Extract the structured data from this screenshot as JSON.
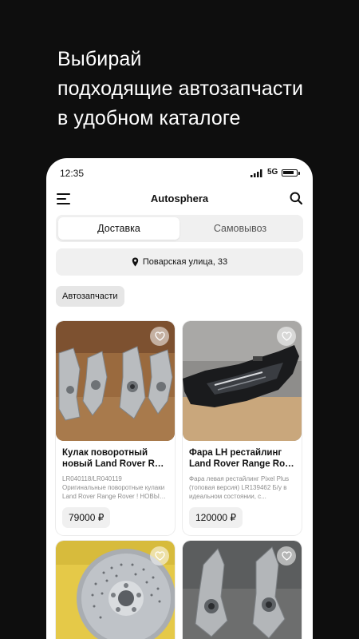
{
  "promo": {
    "line1": "Выбирай",
    "line2": "подходящие автозапчасти",
    "line3": "в удобном каталоге"
  },
  "status_bar": {
    "time": "12:35",
    "network": "5G"
  },
  "app": {
    "title": "Autosphera",
    "menu_icon": "menu-icon",
    "search_icon": "search-icon"
  },
  "delivery_toggle": {
    "options": [
      "Доставка",
      "Самовывоз"
    ],
    "selected": "Доставка"
  },
  "address": {
    "icon": "location-pin-icon",
    "text": "Поварская улица, 33"
  },
  "category_chip": "Автозапчасти",
  "products": [
    {
      "title_line1": "Кулак поворотный",
      "title_line2": "новый Land Rover Range...",
      "desc_line1": "LR040118/LR040119",
      "desc_line2": "Оригинальные поворотные кулаки",
      "desc_line3": "Land Rover Range Rover ! НОВЫЙ!...",
      "price": "79000 ₽",
      "image": "steering-knuckles-photo"
    },
    {
      "title_line1": "Фара LH рестайлинг",
      "title_line2": "Land Rover Range Rove...",
      "desc_line1": "Фара левая рестайлинг Pixel Plus",
      "desc_line2": "(топовая версия) LR139462 Б/у в",
      "desc_line3": "идеальном состоянии, с...",
      "price": "120000 ₽",
      "image": "headlight-photo"
    },
    {
      "image": "brake-disc-photo"
    },
    {
      "image": "steering-knuckles-photo-2"
    }
  ],
  "colors": {
    "background": "#0e0e0e",
    "surface": "#ffffff",
    "chip": "#f0f0f0",
    "text": "#111111",
    "muted": "#8e8e8e"
  }
}
